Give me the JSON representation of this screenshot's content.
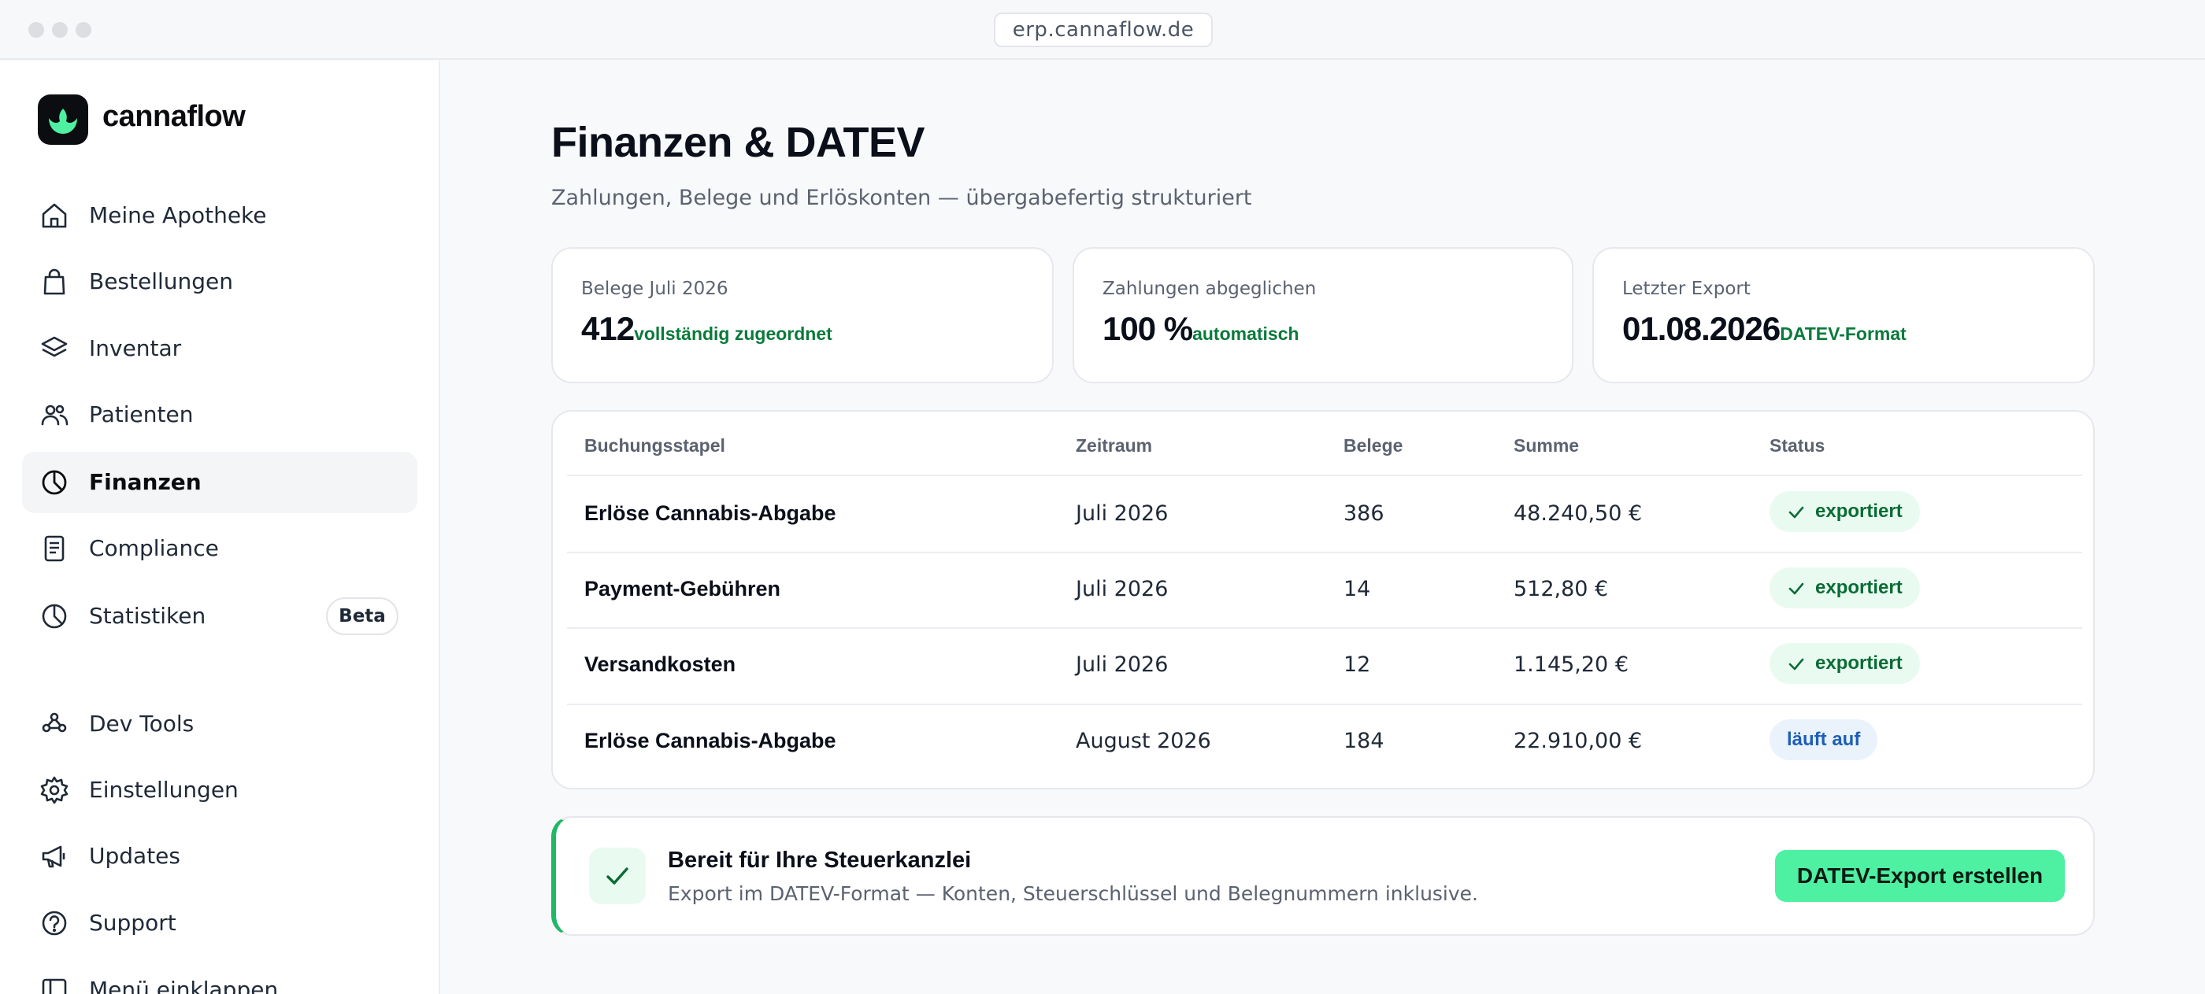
{
  "browser": {
    "url": "erp.cannaflow.de"
  },
  "brand": {
    "name": "cannaflow"
  },
  "sidebar": {
    "items": [
      {
        "label": "Meine Apotheke",
        "icon": "home-icon"
      },
      {
        "label": "Bestellungen",
        "icon": "shopping-bag-icon"
      },
      {
        "label": "Inventar",
        "icon": "layers-icon"
      },
      {
        "label": "Patienten",
        "icon": "users-icon"
      },
      {
        "label": "Finanzen",
        "icon": "pie-chart-icon",
        "active": true
      },
      {
        "label": "Compliance",
        "icon": "document-icon"
      },
      {
        "label": "Statistiken",
        "icon": "pie-chart-icon",
        "badge": "Beta"
      },
      {
        "label": "Dev Tools",
        "icon": "webhook-icon"
      },
      {
        "label": "Einstellungen",
        "icon": "gear-icon"
      },
      {
        "label": "Updates",
        "icon": "megaphone-icon"
      },
      {
        "label": "Support",
        "icon": "help-circle-icon"
      },
      {
        "label": "Menü einklappen",
        "icon": "collapse-icon"
      }
    ]
  },
  "page": {
    "title": "Finanzen & DATEV",
    "subtitle": "Zahlungen, Belege und Erlöskonten — übergabefertig strukturiert"
  },
  "stats": [
    {
      "label": "Belege Juli 2026",
      "value": "412",
      "note": "vollständig zugeordnet"
    },
    {
      "label": "Zahlungen abgeglichen",
      "value": "100 %",
      "note": "automatisch"
    },
    {
      "label": "Letzter Export",
      "value": "01.08.2026",
      "note": "DATEV-Format"
    }
  ],
  "table": {
    "headers": [
      "Buchungsstapel",
      "Zeitraum",
      "Belege",
      "Summe",
      "Status"
    ],
    "rows": [
      {
        "name": "Erlöse Cannabis-Abgabe",
        "period": "Juli 2026",
        "count": "386",
        "sum": "48.240,50 €",
        "status": "exportiert",
        "state": "done"
      },
      {
        "name": "Payment-Gebühren",
        "period": "Juli 2026",
        "count": "14",
        "sum": "512,80 €",
        "status": "exportiert",
        "state": "done"
      },
      {
        "name": "Versandkosten",
        "period": "Juli 2026",
        "count": "12",
        "sum": "1.145,20 €",
        "status": "exportiert",
        "state": "done"
      },
      {
        "name": "Erlöse Cannabis-Abgabe",
        "period": "August 2026",
        "count": "184",
        "sum": "22.910,00 €",
        "status": "läuft auf",
        "state": "running"
      }
    ]
  },
  "cta": {
    "title": "Bereit für Ihre Steuerkanzlei",
    "description": "Export im DATEV-Format — Konten, Steuerschlüssel und Belegnummern inklusive.",
    "button_label": "DATEV-Export erstellen"
  },
  "colors": {
    "accent": "#4ef0a2",
    "success_text": "#0a7a3b",
    "info_text": "#1d5fb7",
    "logo_bg": "#0c0d10"
  }
}
